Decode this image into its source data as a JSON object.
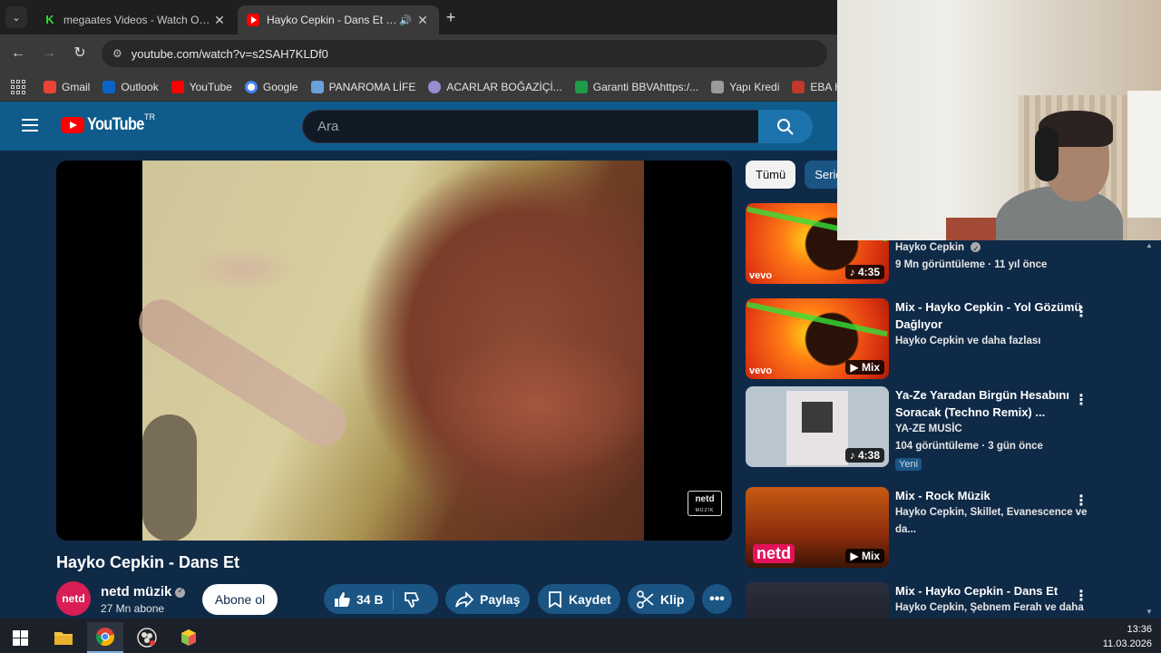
{
  "browser": {
    "tabs": [
      {
        "title": "megaates Videos - Watch On-D",
        "favicon": "kick-icon",
        "active": false
      },
      {
        "title": "Hayko Cepkin - Dans Et - Yo",
        "favicon": "youtube-icon",
        "active": true,
        "audio": true
      }
    ],
    "url": "youtube.com/watch?v=s2SAH7KLDf0",
    "bookmarks": [
      {
        "label": "Gmail",
        "color": "#ea4335"
      },
      {
        "label": "Outlook",
        "color": "#0a64c8"
      },
      {
        "label": "YouTube",
        "color": "#ff0000"
      },
      {
        "label": "Google",
        "color": "#4285f4"
      },
      {
        "label": "PANAROMA LİFE",
        "color": "#6aa0d8"
      },
      {
        "label": "ACARLAR BOĞAZİÇİ...",
        "color": "#9b8bd1"
      },
      {
        "label": "Garanti BBVAhttps:/...",
        "color": "#1e9c4a"
      },
      {
        "label": "Yapı Kredi",
        "color": "#9a9a9a"
      },
      {
        "label": "EBA Hesabı",
        "color": "#c0392b"
      }
    ]
  },
  "youtube": {
    "logo_text": "YouTube",
    "country_code": "TR",
    "search_placeholder": "Ara",
    "video": {
      "title": "Hayko Cepkin - Dans Et",
      "channel": "netd müzik",
      "channel_avatar_text": "netd",
      "subscribers": "27 Mn abone",
      "subscribe_label": "Abone ol",
      "likes": "34 B",
      "share_label": "Paylaş",
      "save_label": "Kaydet",
      "clip_label": "Klip",
      "watermark": "netd",
      "watermark_sub": "MÜZİK"
    },
    "chips": [
      "Tümü",
      "Seriden"
    ],
    "recommendations": [
      {
        "title": "",
        "channel": "Hayko Cepkin",
        "meta": "9 Mn görüntüleme · 11 yıl önce",
        "badge": "4:35"
      },
      {
        "title": "Mix - Hayko Cepkin - Yol Gözümü Dağlıyor",
        "channel": "Hayko Cepkin ve daha fazlası",
        "meta": "",
        "badge": "Mix"
      },
      {
        "title": "Ya-Ze Yaradan Birgün Hesabını Soracak (Techno Remix) ...",
        "channel": "YA-ZE MUSİC",
        "meta": "104 görüntüleme · 3 gün önce",
        "badge": "4:38",
        "new": "Yeni"
      },
      {
        "title": "Mix - Rock Müzik",
        "channel": "Hayko Cepkin, Skillet, Evanescence ve da...",
        "meta": "",
        "badge": "Mix",
        "thumb_logo": "netd"
      },
      {
        "title": "Mix - Hayko Cepkin - Dans Et",
        "channel": "Hayko Cepkin, Şebnem Ferah ve daha fa...",
        "meta": "",
        "badge": ""
      }
    ]
  },
  "taskbar": {
    "time": "13:36",
    "date": "11.03.2026"
  }
}
